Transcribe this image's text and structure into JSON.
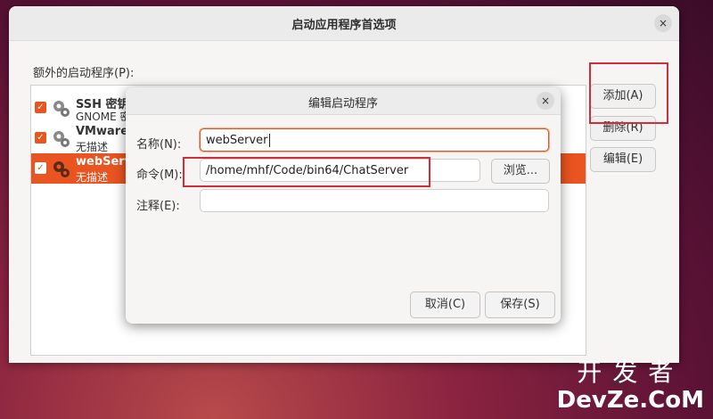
{
  "main_window": {
    "title": "启动应用程序首选项",
    "close": "×",
    "list_label": "额外的启动程序(P):",
    "items": [
      {
        "name": "SSH 密钥",
        "desc": "GNOME 密",
        "checked": "✓"
      },
      {
        "name": "VMware U",
        "desc": "无描述",
        "checked": "✓"
      },
      {
        "name": "webServe",
        "desc": "无描述",
        "checked": "✓"
      }
    ],
    "buttons": {
      "add": "添加(A)",
      "remove": "删除(R)",
      "edit": "编辑(E)"
    },
    "partial_bottom": "关"
  },
  "dialog": {
    "title": "编辑启动程序",
    "close": "×",
    "name_label": "名称(N):",
    "name_value": "webServer",
    "command_label": "命令(M):",
    "command_value": "/home/mhf/Code/bin64/ChatServer",
    "browse": "浏览...",
    "comment_label": "注释(E):",
    "comment_value": "",
    "cancel": "取消(C)",
    "save": "保存(S)"
  },
  "watermark": {
    "line1": "开发者",
    "line2": "DevZe.CoM"
  },
  "colors": {
    "accent": "#e95420",
    "highlight_box": "#d42d3a"
  }
}
